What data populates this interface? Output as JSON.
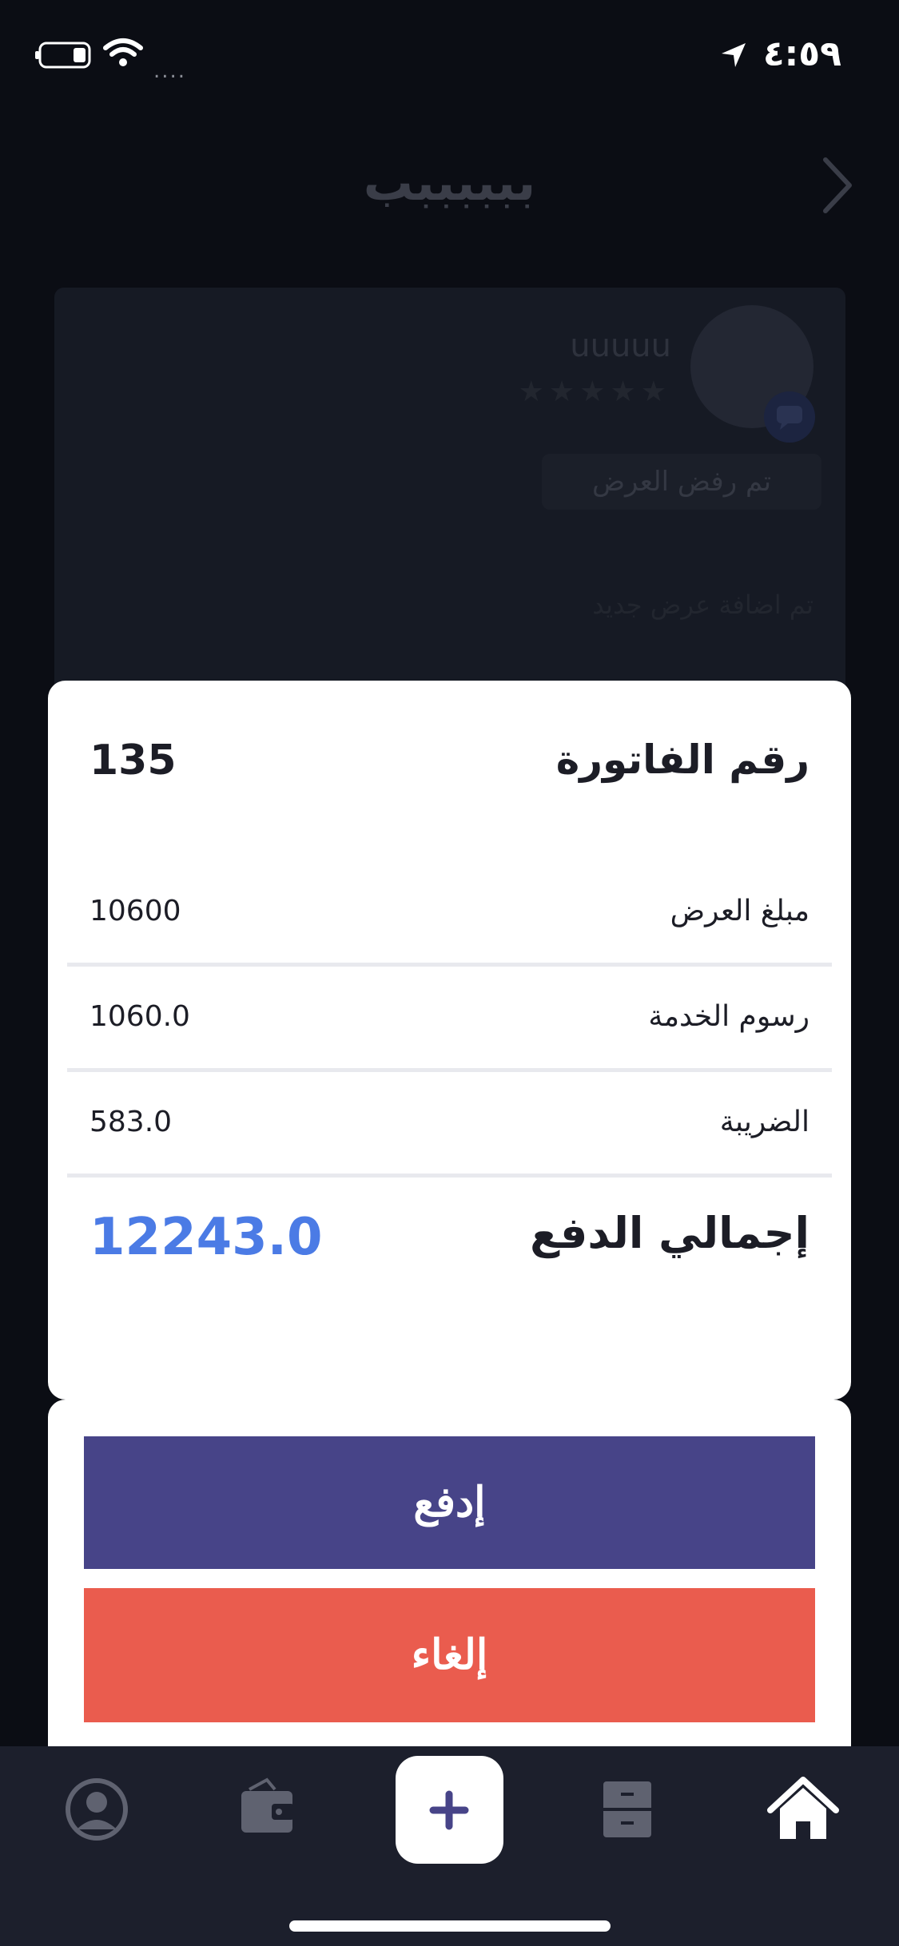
{
  "status_bar": {
    "time": "٤:٥٩",
    "signal_text": "....",
    "icons": [
      "location-arrow-icon",
      "battery-icon",
      "wifi-icon"
    ]
  },
  "background": {
    "page_title": "ببببببب",
    "offer": {
      "user_name": "uuuuu",
      "stars": "★★★★★",
      "status": "تم رفض العرض",
      "note": "تم اضافة عرض جديد"
    }
  },
  "invoice": {
    "number_label": "رقم الفاتورة",
    "number_value": "135",
    "lines": [
      {
        "label": "مبلغ العرض",
        "value": "10600"
      },
      {
        "label": "رسوم الخدمة",
        "value": "1060.0"
      },
      {
        "label": "الضريبة",
        "value": "583.0"
      }
    ],
    "total_label": "إجمالي الدفع",
    "total_value": "12243.0"
  },
  "actions": {
    "pay_label": "إدفع",
    "cancel_label": "إلغاء"
  },
  "tab_bar": {
    "tabs": [
      "profile-icon",
      "wallet-icon",
      "add-icon",
      "files-icon",
      "home-icon"
    ]
  },
  "colors": {
    "accent_total": "#4b7be5",
    "pay_button": "#474488",
    "cancel_button": "#ea5c4e",
    "tab_bar_bg": "#1c1f2c"
  }
}
